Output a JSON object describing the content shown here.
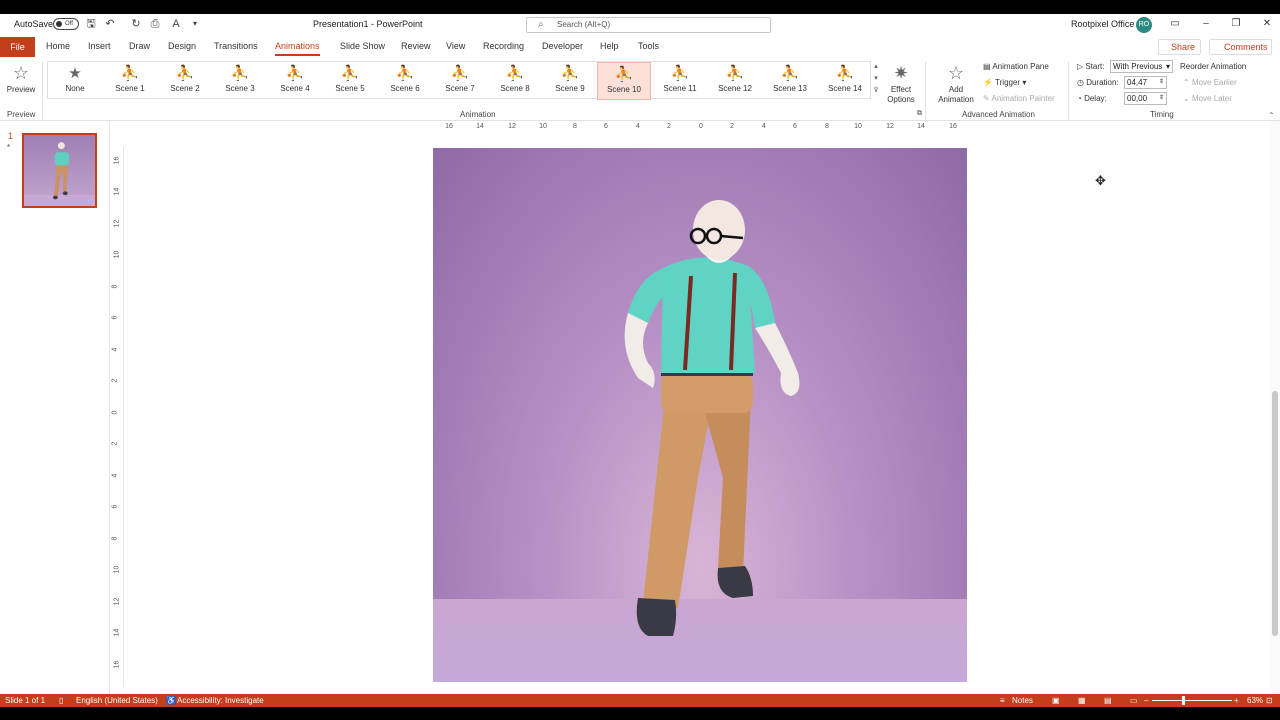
{
  "titlebar": {
    "autosave_label": "AutoSave",
    "autosave_state": "Off",
    "window_title": "Presentation1  -  PowerPoint",
    "search_placeholder": "Search (Alt+Q)",
    "user_name": "Rootpixel Office",
    "user_initials": "RO"
  },
  "tabs": {
    "file": "File",
    "items": [
      "Home",
      "Insert",
      "Draw",
      "Design",
      "Transitions",
      "Animations",
      "Slide Show",
      "Review",
      "View",
      "Recording",
      "Developer",
      "Help",
      "Tools"
    ],
    "active": "Animations",
    "share": "Share",
    "comments": "Comments"
  },
  "ribbon": {
    "preview": {
      "label": "Preview",
      "group": "Preview"
    },
    "animation_group": "Animation",
    "gallery": [
      "None",
      "Scene 1",
      "Scene 2",
      "Scene 3",
      "Scene 4",
      "Scene 5",
      "Scene 6",
      "Scene 7",
      "Scene 8",
      "Scene 9",
      "Scene 10",
      "Scene 11",
      "Scene 12",
      "Scene 13",
      "Scene 14"
    ],
    "selected_item": "Scene 10",
    "effect_options": "Effect Options",
    "add_animation": "Add Animation",
    "animation_pane": "Animation Pane",
    "trigger": "Trigger",
    "animation_painter": "Animation Painter",
    "advanced_group": "Advanced Animation",
    "start_label": "Start:",
    "start_value": "With Previous",
    "duration_label": "Duration:",
    "duration_value": "04,47",
    "delay_label": "Delay:",
    "delay_value": "00,00",
    "reorder": "Reorder Animation",
    "move_earlier": "Move Earlier",
    "move_later": "Move Later",
    "timing_group": "Timing"
  },
  "slides_pane": {
    "number": "1",
    "star": "*"
  },
  "ruler": {
    "h": [
      "16",
      "14",
      "12",
      "10",
      "8",
      "6",
      "4",
      "2",
      "0",
      "2",
      "4",
      "6",
      "8",
      "10",
      "12",
      "14",
      "16"
    ],
    "v": [
      "16",
      "14",
      "12",
      "10",
      "8",
      "6",
      "4",
      "2",
      "0",
      "2",
      "4",
      "6",
      "8",
      "10",
      "12",
      "14",
      "16"
    ]
  },
  "status": {
    "slide": "Slide 1 of 1",
    "language": "English (United States)",
    "accessibility": "Accessibility: Investigate",
    "notes": "Notes",
    "zoom": "63%"
  },
  "colors": {
    "accent": "#c43e1c",
    "avatar": "#2b8a82"
  }
}
